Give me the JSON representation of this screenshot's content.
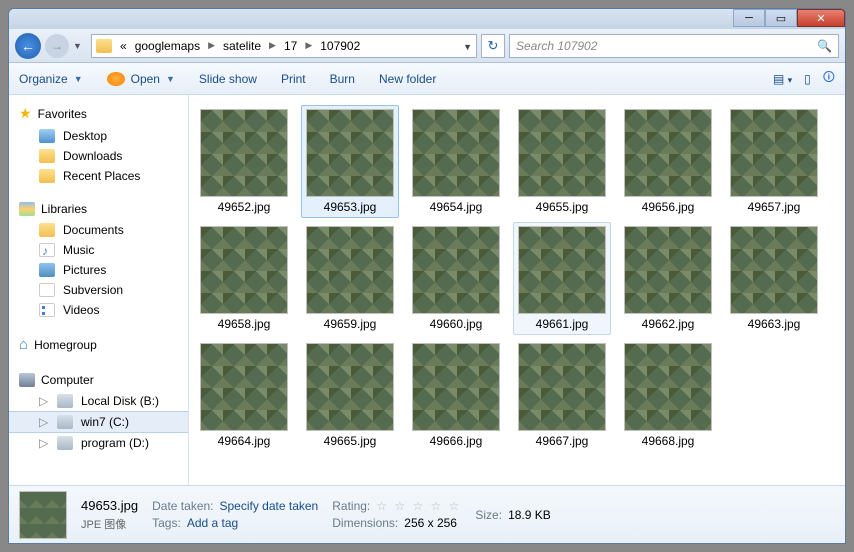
{
  "breadcrumbs": [
    "googlemaps",
    "satelite",
    "17",
    "107902"
  ],
  "search": {
    "placeholder": "Search 107902"
  },
  "toolbar": {
    "organize": "Organize",
    "open": "Open",
    "slideshow": "Slide show",
    "print": "Print",
    "burn": "Burn",
    "newfolder": "New folder"
  },
  "sidebar": {
    "favorites": {
      "label": "Favorites",
      "items": [
        "Desktop",
        "Downloads",
        "Recent Places"
      ]
    },
    "libraries": {
      "label": "Libraries",
      "items": [
        "Documents",
        "Music",
        "Pictures",
        "Subversion",
        "Videos"
      ]
    },
    "homegroup": {
      "label": "Homegroup"
    },
    "computer": {
      "label": "Computer",
      "items": [
        "Local Disk (B:)",
        "win7 (C:)",
        "program (D:)"
      ]
    }
  },
  "files": [
    {
      "name": "49652.jpg"
    },
    {
      "name": "49653.jpg",
      "selected": true
    },
    {
      "name": "49654.jpg"
    },
    {
      "name": "49655.jpg"
    },
    {
      "name": "49656.jpg"
    },
    {
      "name": "49657.jpg"
    },
    {
      "name": "49658.jpg"
    },
    {
      "name": "49659.jpg"
    },
    {
      "name": "49660.jpg"
    },
    {
      "name": "49661.jpg",
      "hover": true
    },
    {
      "name": "49662.jpg"
    },
    {
      "name": "49663.jpg"
    },
    {
      "name": "49664.jpg"
    },
    {
      "name": "49665.jpg"
    },
    {
      "name": "49666.jpg"
    },
    {
      "name": "49667.jpg"
    },
    {
      "name": "49668.jpg"
    }
  ],
  "details": {
    "filename": "49653.jpg",
    "filetype": "JPE 图像",
    "date_label": "Date taken:",
    "date_value": "Specify date taken",
    "tags_label": "Tags:",
    "tags_value": "Add a tag",
    "rating_label": "Rating:",
    "dimensions_label": "Dimensions:",
    "dimensions_value": "256 x 256",
    "size_label": "Size:",
    "size_value": "18.9 KB"
  }
}
